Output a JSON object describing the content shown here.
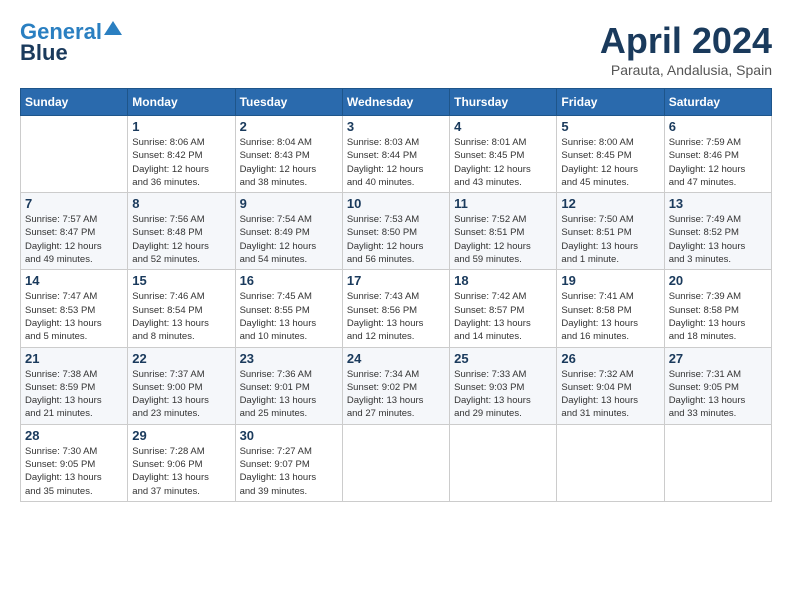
{
  "logo": {
    "line1": "General",
    "line2": "Blue"
  },
  "title": "April 2024",
  "subtitle": "Parauta, Andalusia, Spain",
  "weekdays": [
    "Sunday",
    "Monday",
    "Tuesday",
    "Wednesday",
    "Thursday",
    "Friday",
    "Saturday"
  ],
  "weeks": [
    [
      {
        "day": "",
        "info": ""
      },
      {
        "day": "1",
        "info": "Sunrise: 8:06 AM\nSunset: 8:42 PM\nDaylight: 12 hours\nand 36 minutes."
      },
      {
        "day": "2",
        "info": "Sunrise: 8:04 AM\nSunset: 8:43 PM\nDaylight: 12 hours\nand 38 minutes."
      },
      {
        "day": "3",
        "info": "Sunrise: 8:03 AM\nSunset: 8:44 PM\nDaylight: 12 hours\nand 40 minutes."
      },
      {
        "day": "4",
        "info": "Sunrise: 8:01 AM\nSunset: 8:45 PM\nDaylight: 12 hours\nand 43 minutes."
      },
      {
        "day": "5",
        "info": "Sunrise: 8:00 AM\nSunset: 8:45 PM\nDaylight: 12 hours\nand 45 minutes."
      },
      {
        "day": "6",
        "info": "Sunrise: 7:59 AM\nSunset: 8:46 PM\nDaylight: 12 hours\nand 47 minutes."
      }
    ],
    [
      {
        "day": "7",
        "info": "Sunrise: 7:57 AM\nSunset: 8:47 PM\nDaylight: 12 hours\nand 49 minutes."
      },
      {
        "day": "8",
        "info": "Sunrise: 7:56 AM\nSunset: 8:48 PM\nDaylight: 12 hours\nand 52 minutes."
      },
      {
        "day": "9",
        "info": "Sunrise: 7:54 AM\nSunset: 8:49 PM\nDaylight: 12 hours\nand 54 minutes."
      },
      {
        "day": "10",
        "info": "Sunrise: 7:53 AM\nSunset: 8:50 PM\nDaylight: 12 hours\nand 56 minutes."
      },
      {
        "day": "11",
        "info": "Sunrise: 7:52 AM\nSunset: 8:51 PM\nDaylight: 12 hours\nand 59 minutes."
      },
      {
        "day": "12",
        "info": "Sunrise: 7:50 AM\nSunset: 8:51 PM\nDaylight: 13 hours\nand 1 minute."
      },
      {
        "day": "13",
        "info": "Sunrise: 7:49 AM\nSunset: 8:52 PM\nDaylight: 13 hours\nand 3 minutes."
      }
    ],
    [
      {
        "day": "14",
        "info": "Sunrise: 7:47 AM\nSunset: 8:53 PM\nDaylight: 13 hours\nand 5 minutes."
      },
      {
        "day": "15",
        "info": "Sunrise: 7:46 AM\nSunset: 8:54 PM\nDaylight: 13 hours\nand 8 minutes."
      },
      {
        "day": "16",
        "info": "Sunrise: 7:45 AM\nSunset: 8:55 PM\nDaylight: 13 hours\nand 10 minutes."
      },
      {
        "day": "17",
        "info": "Sunrise: 7:43 AM\nSunset: 8:56 PM\nDaylight: 13 hours\nand 12 minutes."
      },
      {
        "day": "18",
        "info": "Sunrise: 7:42 AM\nSunset: 8:57 PM\nDaylight: 13 hours\nand 14 minutes."
      },
      {
        "day": "19",
        "info": "Sunrise: 7:41 AM\nSunset: 8:58 PM\nDaylight: 13 hours\nand 16 minutes."
      },
      {
        "day": "20",
        "info": "Sunrise: 7:39 AM\nSunset: 8:58 PM\nDaylight: 13 hours\nand 18 minutes."
      }
    ],
    [
      {
        "day": "21",
        "info": "Sunrise: 7:38 AM\nSunset: 8:59 PM\nDaylight: 13 hours\nand 21 minutes."
      },
      {
        "day": "22",
        "info": "Sunrise: 7:37 AM\nSunset: 9:00 PM\nDaylight: 13 hours\nand 23 minutes."
      },
      {
        "day": "23",
        "info": "Sunrise: 7:36 AM\nSunset: 9:01 PM\nDaylight: 13 hours\nand 25 minutes."
      },
      {
        "day": "24",
        "info": "Sunrise: 7:34 AM\nSunset: 9:02 PM\nDaylight: 13 hours\nand 27 minutes."
      },
      {
        "day": "25",
        "info": "Sunrise: 7:33 AM\nSunset: 9:03 PM\nDaylight: 13 hours\nand 29 minutes."
      },
      {
        "day": "26",
        "info": "Sunrise: 7:32 AM\nSunset: 9:04 PM\nDaylight: 13 hours\nand 31 minutes."
      },
      {
        "day": "27",
        "info": "Sunrise: 7:31 AM\nSunset: 9:05 PM\nDaylight: 13 hours\nand 33 minutes."
      }
    ],
    [
      {
        "day": "28",
        "info": "Sunrise: 7:30 AM\nSunset: 9:05 PM\nDaylight: 13 hours\nand 35 minutes."
      },
      {
        "day": "29",
        "info": "Sunrise: 7:28 AM\nSunset: 9:06 PM\nDaylight: 13 hours\nand 37 minutes."
      },
      {
        "day": "30",
        "info": "Sunrise: 7:27 AM\nSunset: 9:07 PM\nDaylight: 13 hours\nand 39 minutes."
      },
      {
        "day": "",
        "info": ""
      },
      {
        "day": "",
        "info": ""
      },
      {
        "day": "",
        "info": ""
      },
      {
        "day": "",
        "info": ""
      }
    ]
  ]
}
